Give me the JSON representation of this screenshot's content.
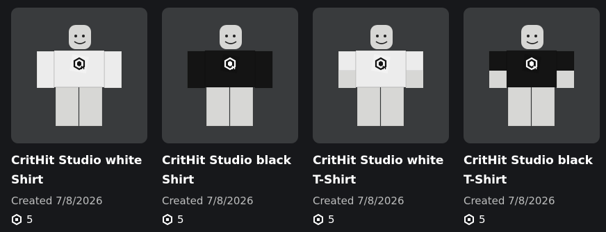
{
  "items": [
    {
      "title": "CritHit Studio white Shirt",
      "created": "Created 7/8/2026",
      "price": "5",
      "garment": "shirt",
      "color": "#ececec"
    },
    {
      "title": "CritHit Studio black Shirt",
      "created": "Created 7/8/2026",
      "price": "5",
      "garment": "shirt",
      "color": "#141414"
    },
    {
      "title": "CritHit Studio white T-Shirt",
      "created": "Created 7/8/2026",
      "price": "5",
      "garment": "tshirt",
      "color": "#ececec"
    },
    {
      "title": "CritHit Studio black T-Shirt",
      "created": "Created 7/8/2026",
      "price": "5",
      "garment": "tshirt",
      "color": "#141414"
    }
  ],
  "icons": {
    "currency": "robux-icon"
  },
  "colors": {
    "background": "#17181b",
    "card": "#393b3d",
    "skin": "#d7d7d5"
  }
}
